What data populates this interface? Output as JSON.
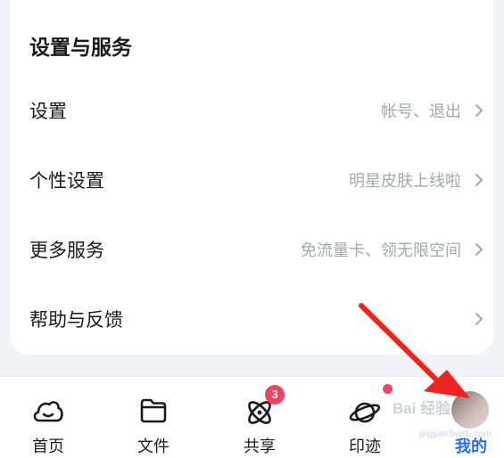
{
  "settings_section": {
    "title": "设置与服务",
    "items": [
      {
        "label": "设置",
        "desc": "帐号、退出"
      },
      {
        "label": "个性设置",
        "desc": "明星皮肤上线啦"
      },
      {
        "label": "更多服务",
        "desc": "免流量卡、领无限空间"
      },
      {
        "label": "帮助与反馈",
        "desc": ""
      }
    ]
  },
  "tabbar": {
    "tabs": [
      {
        "label": "首页",
        "icon": "cloud-icon"
      },
      {
        "label": "文件",
        "icon": "folder-icon"
      },
      {
        "label": "共享",
        "icon": "atom-icon",
        "badge": "3"
      },
      {
        "label": "印迹",
        "icon": "planet-icon",
        "dot": true
      },
      {
        "label": "我的",
        "icon": "avatar",
        "active": true
      }
    ]
  },
  "watermark": {
    "text": "Bai 经验",
    "sub": "jingyan.baidu.com"
  },
  "colors": {
    "accent": "#2a6cf6",
    "badge": "#f4435f",
    "annotation_arrow": "#f0241f",
    "muted_text": "#a4a7ae"
  }
}
